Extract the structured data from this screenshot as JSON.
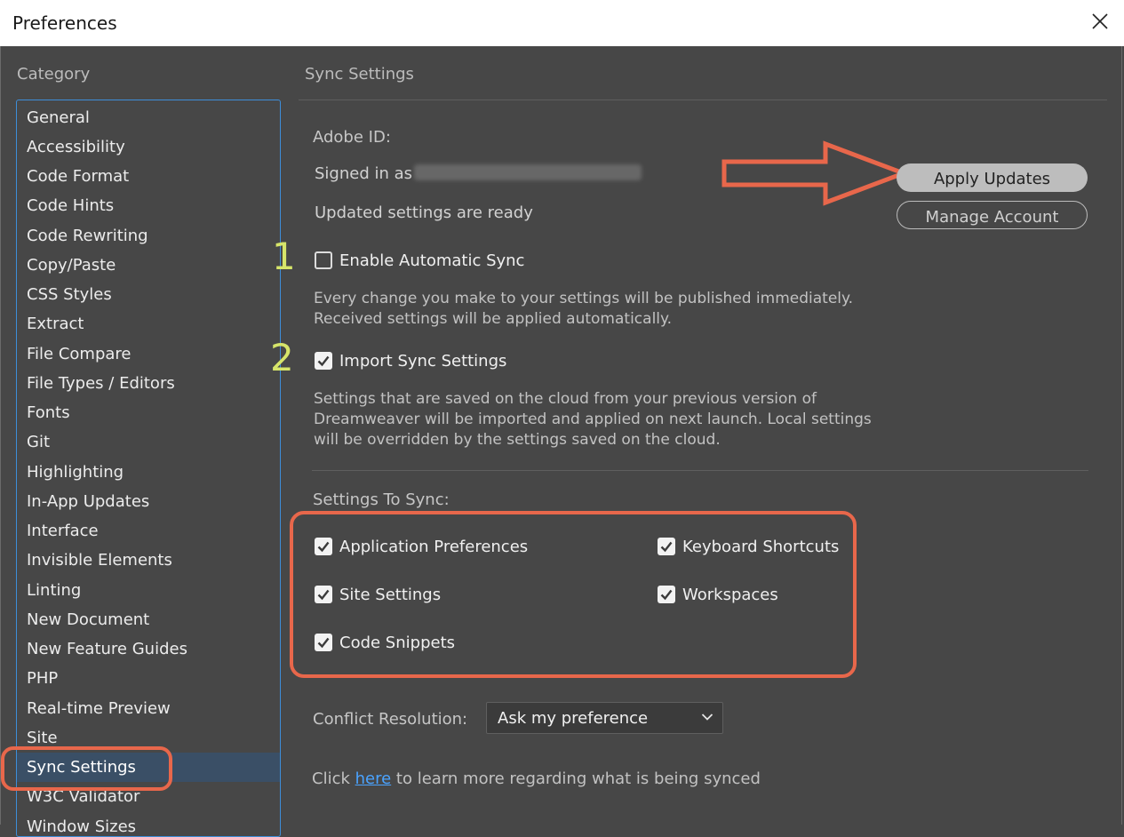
{
  "window": {
    "title": "Preferences"
  },
  "sidebar": {
    "label": "Category",
    "items": [
      {
        "label": "General"
      },
      {
        "label": "Accessibility"
      },
      {
        "label": "Code Format"
      },
      {
        "label": "Code Hints"
      },
      {
        "label": "Code Rewriting"
      },
      {
        "label": "Copy/Paste"
      },
      {
        "label": "CSS Styles"
      },
      {
        "label": "Extract"
      },
      {
        "label": "File Compare"
      },
      {
        "label": "File Types / Editors"
      },
      {
        "label": "Fonts"
      },
      {
        "label": "Git"
      },
      {
        "label": "Highlighting"
      },
      {
        "label": "In-App Updates"
      },
      {
        "label": "Interface"
      },
      {
        "label": "Invisible Elements"
      },
      {
        "label": "Linting"
      },
      {
        "label": "New Document"
      },
      {
        "label": "New Feature Guides"
      },
      {
        "label": "PHP"
      },
      {
        "label": "Real-time Preview"
      },
      {
        "label": "Site"
      },
      {
        "label": "Sync Settings",
        "selected": true
      },
      {
        "label": "W3C Validator"
      },
      {
        "label": "Window Sizes"
      }
    ]
  },
  "main": {
    "title": "Sync Settings",
    "adobe_id_label": "Adobe ID:",
    "signed_in_prefix": "Signed in as",
    "updated_status": "Updated settings are ready",
    "apply_button": "Apply Updates",
    "manage_button": "Manage Account",
    "step1": "1",
    "step2": "2",
    "enable_auto_sync": {
      "label": "Enable Automatic Sync",
      "checked": false
    },
    "auto_sync_desc": [
      "Every change you make to your settings will be published immediately.",
      "Received settings will be applied automatically."
    ],
    "import_sync": {
      "label": "Import Sync Settings",
      "checked": true
    },
    "import_desc": [
      "Settings that are saved on the cloud from your previous version of",
      "Dreamweaver will be imported and applied on next launch. Local settings",
      "will be overridden by the settings saved on the cloud."
    ],
    "settings_to_sync_label": "Settings To Sync:",
    "sync_options": {
      "app_prefs": {
        "label": "Application Preferences",
        "checked": true
      },
      "keyboard": {
        "label": "Keyboard Shortcuts",
        "checked": true
      },
      "site": {
        "label": "Site Settings",
        "checked": true
      },
      "workspaces": {
        "label": "Workspaces",
        "checked": true
      },
      "snippets": {
        "label": "Code Snippets",
        "checked": true
      }
    },
    "conflict_label": "Conflict Resolution:",
    "conflict_value": "Ask my preference",
    "footer_prefix": "Click",
    "footer_link": "here",
    "footer_suffix": "to learn more regarding what is being synced"
  },
  "colors": {
    "annotation": "#e8674b",
    "step_number": "#d6e56a",
    "selection": "#3a4f66",
    "link": "#4aa3ff"
  }
}
